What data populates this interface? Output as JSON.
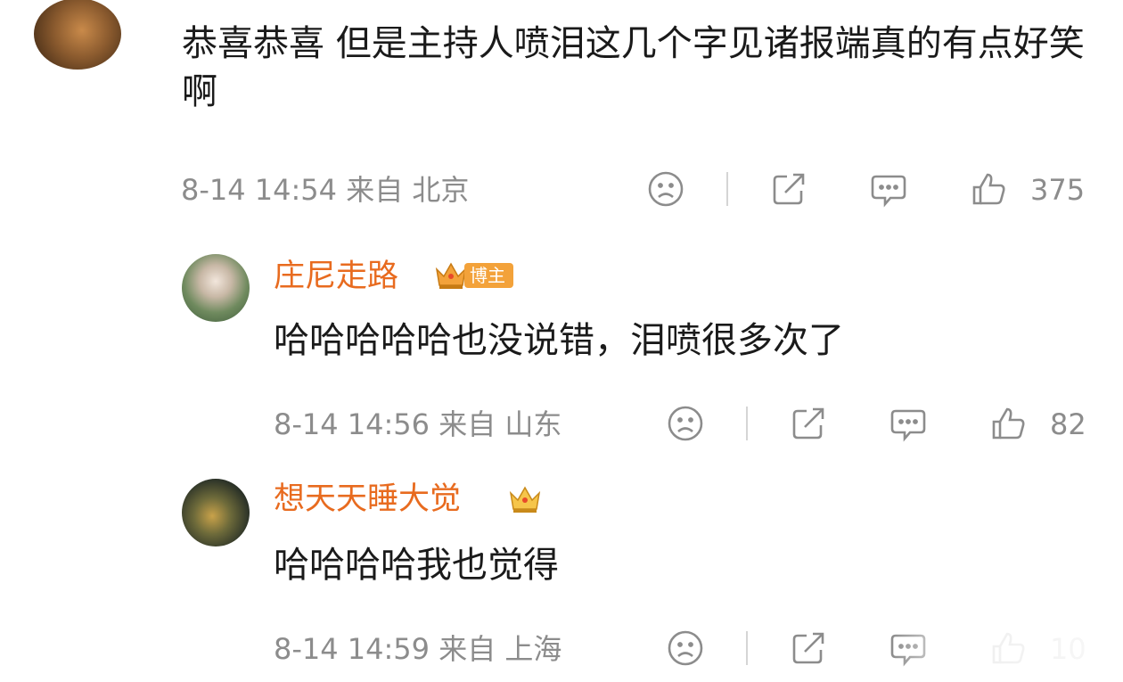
{
  "comment": {
    "text": "恭喜恭喜 但是主持人喷泪这几个字见诸报端真的有点好笑啊",
    "meta": "8-14 14:54 来自 北京",
    "likes": "375"
  },
  "replies": [
    {
      "name": "庄尼走路",
      "badge_label": "博主",
      "text": "哈哈哈哈哈也没说错，泪喷很多次了",
      "meta": "8-14 14:56 来自 山东",
      "likes": "82"
    },
    {
      "name": "想天天睡大觉",
      "text": "哈哈哈哈我也觉得",
      "meta": "8-14 14:59 来自 上海",
      "likes": "10"
    }
  ],
  "icons": {
    "dislike": "sad-face-icon",
    "share": "share-icon",
    "reply": "comment-icon",
    "like": "thumbs-up-icon",
    "badge": "crown-icon"
  },
  "colors": {
    "username": "#e86b1f",
    "meta": "#8c8c8c",
    "badge": "#f3a23a"
  }
}
